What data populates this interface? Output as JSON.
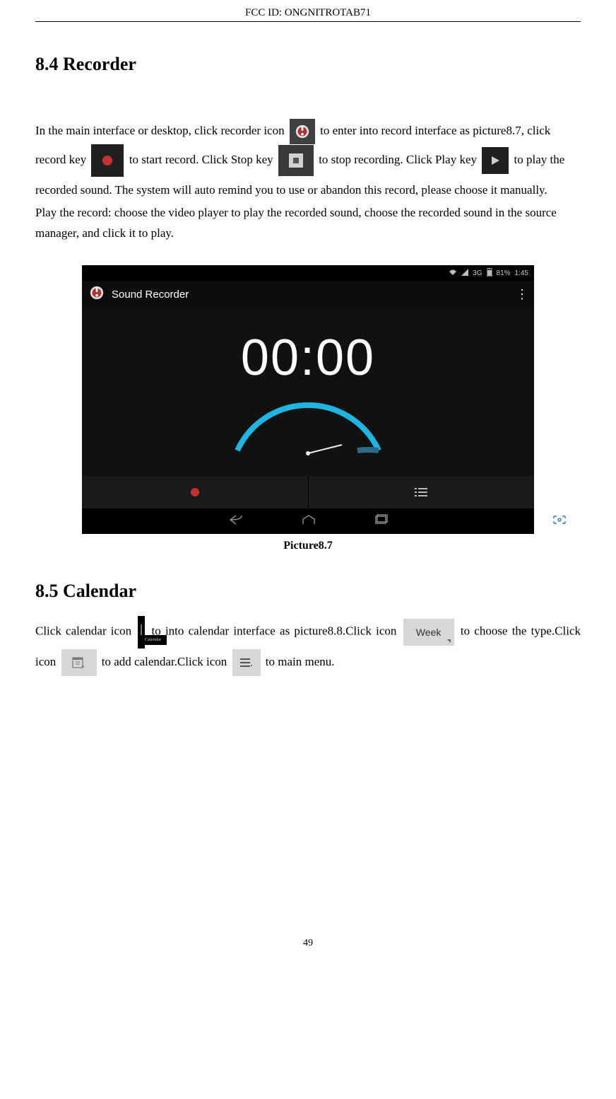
{
  "header": {
    "fcc_label": "FCC ID:",
    "fcc_id": "ONGNITROTAB71"
  },
  "section_recorder": {
    "title": "8.4 Recorder",
    "p1a": "In the main interface or desktop, click recorder icon ",
    "p1b": " to enter into record interface as picture8.7, click record key ",
    "p1c": " to start record. Click Stop key ",
    "p1d": " to stop recording. Click Play key ",
    "p1e": " to play the recorded sound. The system will auto remind you to use or abandon this record, please choose it manually.",
    "p2": "Play the record: choose the video player to play the recorded sound, choose the recorded sound in the source manager, and click it to play."
  },
  "screenshot": {
    "status": {
      "signal": "3G",
      "battery_pct": "81%",
      "time": "1:45"
    },
    "appbar_title": "Sound Recorder",
    "timer": "00:00"
  },
  "caption_87": "Picture8.7",
  "section_calendar": {
    "title": "8.5 Calendar",
    "p1a": "Click calendar icon ",
    "p1b": " to into calendar interface as picture8.8.Click icon ",
    "p1c": " to choose the type.Click icon ",
    "p1d": " to add calendar.Click icon",
    "p1e": " to main menu.",
    "week_label": "Week"
  },
  "page_number": "49"
}
